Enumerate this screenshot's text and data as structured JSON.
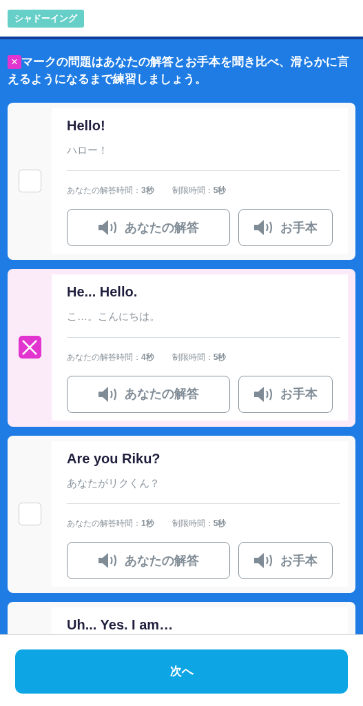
{
  "header": {
    "tag": "シャドーイング"
  },
  "instruction": {
    "mark": "×",
    "text": "マークの問題はあなたの解答とお手本を聞き比べ、滑らかに言えるようになるまで練習しましょう。"
  },
  "items": [
    {
      "title": "Hello!",
      "translation": "ハロー！",
      "answer_time": "あなたの解答時間：**3秒**",
      "limit_time": "制限時間：**5秒**",
      "checked": false,
      "buttons": [
        "あなたの解答",
        "お手本"
      ]
    },
    {
      "title": "He... Hello.",
      "translation": "こ…。こんにちは。",
      "answer_time": "あなたの解答時間：**4秒**",
      "limit_time": "制限時間：**5秒**",
      "checked": true,
      "buttons": [
        "あなたの解答",
        "お手本"
      ]
    },
    {
      "title": "Are you Riku?",
      "translation": "あなたがリクくん？",
      "answer_time": "あなたの解答時間：**1秒**",
      "limit_time": "制限時間：**5秒**",
      "checked": false,
      "buttons": [
        "あなたの解答",
        "お手本"
      ]
    },
    {
      "title": "Uh... Yes. I am…"
    }
  ],
  "footer": {
    "button": "次へ"
  }
}
